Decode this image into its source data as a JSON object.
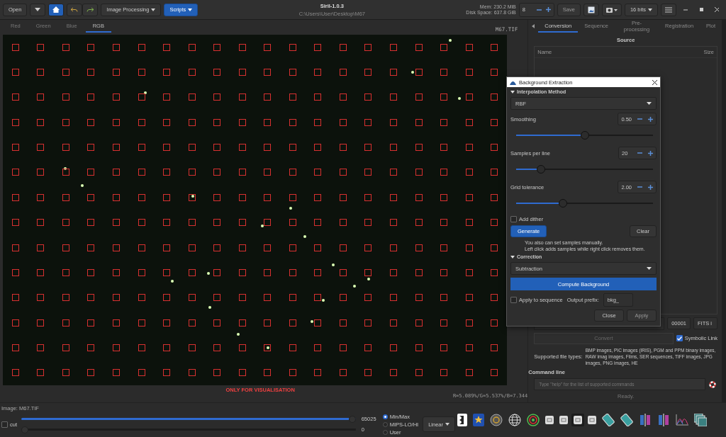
{
  "toolbar": {
    "open": "Open",
    "image_processing": "Image Processing",
    "scripts": "Scripts",
    "title": "Siril-1.0.3",
    "path": "C:\\Users\\User\\Desktop\\M67",
    "mem": "Mem: 230.2 MiB",
    "disk": "Disk Space: 637.8 GiB",
    "threads": "8",
    "save": "Save",
    "bits": "16 bits"
  },
  "channel_tabs": [
    {
      "label": "Red",
      "selected": false
    },
    {
      "label": "Green",
      "selected": false
    },
    {
      "label": "Blue",
      "selected": false
    },
    {
      "label": "RGB",
      "selected": true
    }
  ],
  "image": {
    "filename": "M67.TIF",
    "notice": "ONLY FOR VISUALISATION",
    "readout": "R=5.089%/G=5.537%/B=7.344"
  },
  "panel_tabs": [
    {
      "label": "Conversion",
      "selected": true
    },
    {
      "label": "Sequence",
      "selected": false
    },
    {
      "label": "Pre-processing",
      "selected": false
    },
    {
      "label": "Registration",
      "selected": false
    },
    {
      "label": "Plot",
      "selected": false
    }
  ],
  "conversion": {
    "section": "Source",
    "columns": [
      "Name",
      "Size"
    ],
    "index": "00001",
    "format": "FITS i",
    "convert": "Convert",
    "symbolic_link": {
      "label": "Symbolic Link",
      "checked": true
    },
    "types_label": "Supported file types:",
    "types_text": "BMP images, PIC images (IRIS), PGM and PPM binary images, RAW imag images, Films, SER sequences, TIFF images, JPG images, PNG images, HE"
  },
  "command_line": {
    "title": "Command line",
    "placeholder": "Type \"help\" for the list of supported commands",
    "status": "Ready."
  },
  "display": {
    "image_label": "Image: M67.TIF",
    "cut": {
      "label": "cut",
      "checked": false
    },
    "high": {
      "value": "65025",
      "level": 1.0
    },
    "low": {
      "value": "0",
      "level": 0.0
    },
    "modes": [
      {
        "label": "Min/Max",
        "selected": true
      },
      {
        "label": "MIPS-LO/HI",
        "selected": false
      },
      {
        "label": "User",
        "selected": false
      }
    ],
    "scale": "Linear"
  },
  "dialog": {
    "title": "Background Extraction",
    "interp_title": "Interpolation Method",
    "method": "RBF",
    "params": [
      {
        "label": "Smoothing",
        "value": "0.50",
        "level": 0.5
      },
      {
        "label": "Samples per line",
        "value": "20",
        "level": 0.155
      },
      {
        "label": "Grid tolerance",
        "value": "2.00",
        "level": 0.33
      }
    ],
    "dither": {
      "label": "Add dither",
      "checked": false
    },
    "generate": "Generate",
    "clear": "Clear",
    "hint": [
      "You also can set samples manually.",
      "Left click adds samples while right click removes them."
    ],
    "correction_title": "Correction",
    "correction": "Subtraction",
    "compute": "Compute Background",
    "apply_seq": {
      "label": "Apply to sequence",
      "checked": false
    },
    "prefix_label": "Output prefix:",
    "prefix": "bkg_",
    "close": "Close",
    "apply": "Apply"
  }
}
